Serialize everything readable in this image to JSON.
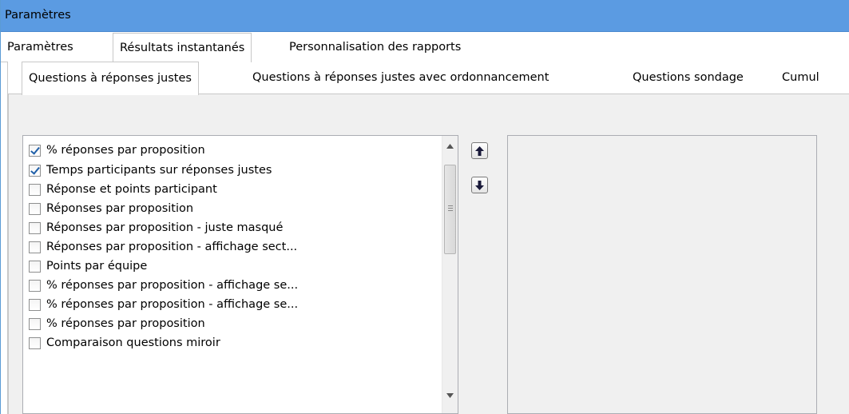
{
  "window": {
    "title": "Paramètres"
  },
  "main_tabs": [
    {
      "label": "Paramètres",
      "active": false
    },
    {
      "label": "Résultats instantanés",
      "active": true
    },
    {
      "label": "Personnalisation des rapports",
      "active": false
    }
  ],
  "sub_tabs": [
    {
      "label": "Questions à réponses justes",
      "active": true
    },
    {
      "label": "Questions à réponses justes avec ordonnancement",
      "active": false
    },
    {
      "label": "Questions sondage",
      "active": false
    },
    {
      "label": "Cumul",
      "active": false
    }
  ],
  "report_list": {
    "items": [
      {
        "label": "% réponses par proposition",
        "checked": true
      },
      {
        "label": "Temps participants sur réponses justes",
        "checked": true
      },
      {
        "label": "Réponse et points participant",
        "checked": false
      },
      {
        "label": "Réponses par proposition",
        "checked": false
      },
      {
        "label": "Réponses par proposition - juste masqué",
        "checked": false
      },
      {
        "label": "Réponses par proposition - affichage sect...",
        "checked": false
      },
      {
        "label": "Points par équipe",
        "checked": false
      },
      {
        "label": "% réponses par proposition - affichage se...",
        "checked": false
      },
      {
        "label": "% réponses par proposition - affichage se...",
        "checked": false
      },
      {
        "label": "% réponses par proposition",
        "checked": false
      },
      {
        "label": "Comparaison questions miroir",
        "checked": false
      }
    ]
  },
  "icons": {
    "move_up": "arrow-up-icon",
    "move_down": "arrow-down-icon",
    "scroll_up": "triangle-up-icon",
    "scroll_down": "triangle-down-icon"
  },
  "colors": {
    "titlebar": "#5b9be2",
    "check_mark": "#1f5fa8",
    "panel_bg": "#f0f0f0"
  }
}
